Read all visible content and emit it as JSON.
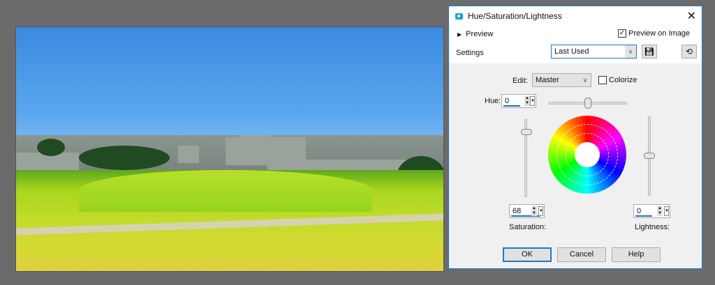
{
  "dialog": {
    "title": "Hue/Saturation/Lightness",
    "preview_label": "Preview",
    "preview_on_image_label": "Preview on Image",
    "preview_on_image_checked": true,
    "settings_label": "Settings",
    "settings_value": "Last Used",
    "edit_label": "Edit:",
    "edit_value": "Master",
    "colorize_label": "Colorize",
    "colorize_checked": false,
    "hue_label": "Hue:",
    "hue_value": "0",
    "saturation_label": "Saturation:",
    "saturation_value": "68",
    "lightness_label": "Lightness:",
    "lightness_value": "0",
    "ok_label": "OK",
    "cancel_label": "Cancel",
    "help_label": "Help"
  },
  "icons": {
    "app": "hsl-app-icon",
    "close": "close-icon",
    "save": "save-icon",
    "reset": "reset-icon"
  }
}
